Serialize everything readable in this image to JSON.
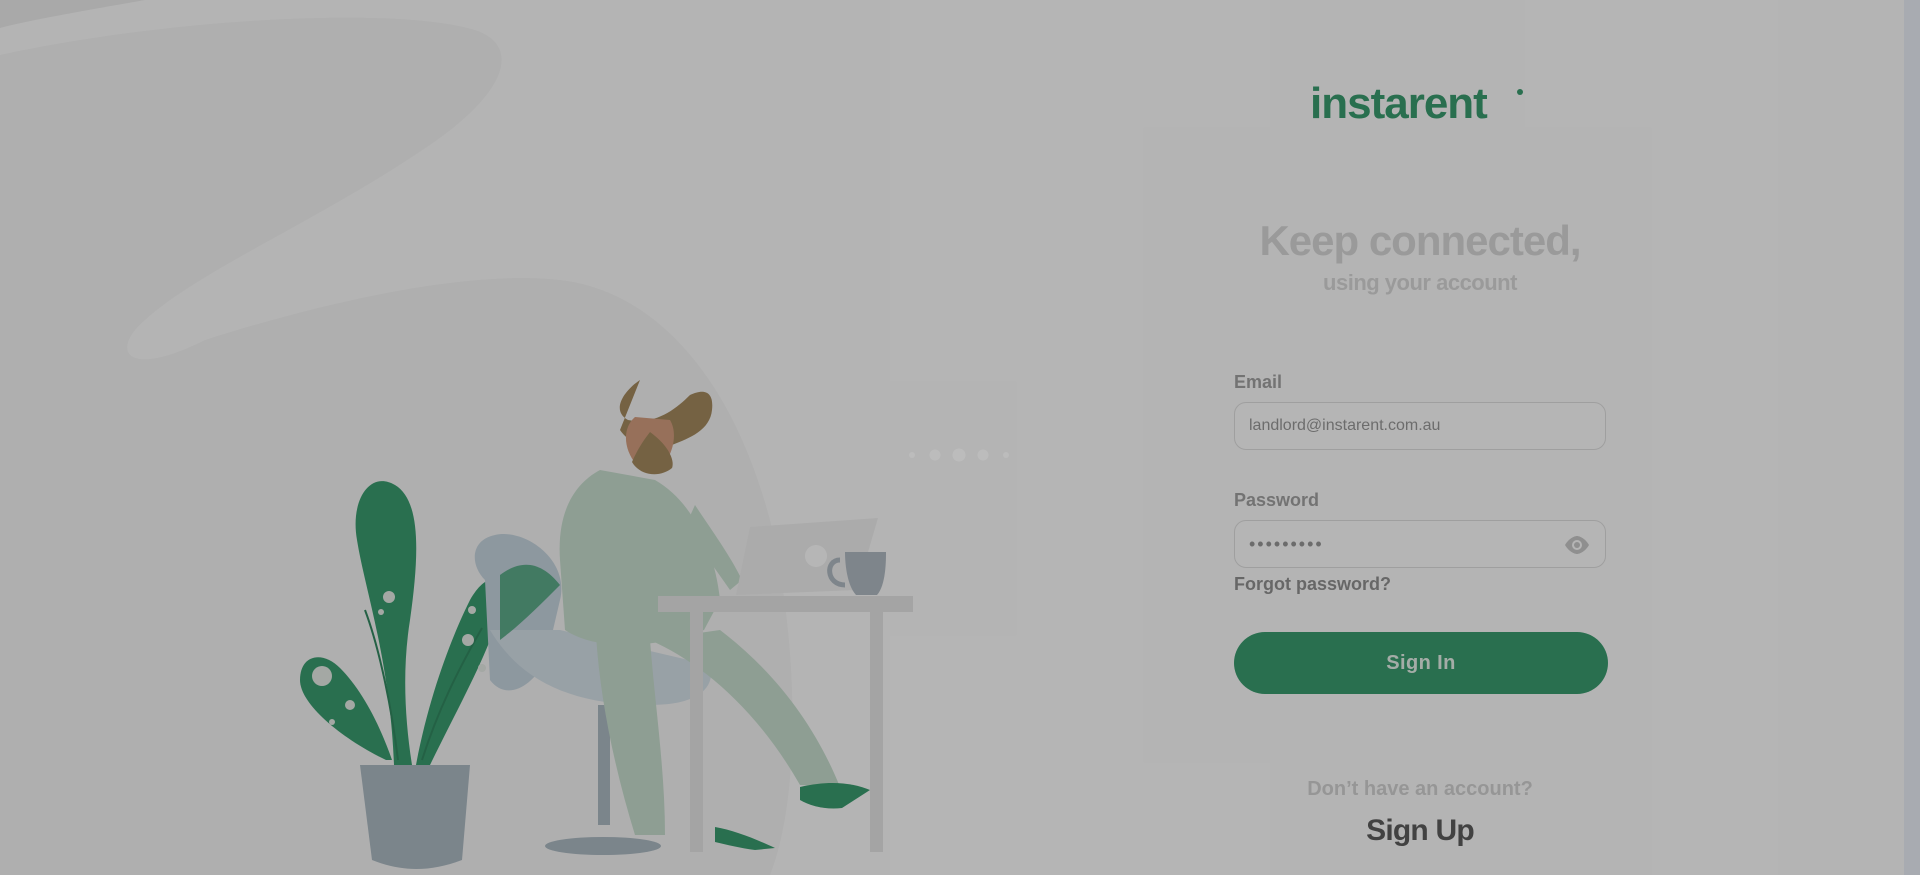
{
  "brand": {
    "logo_text": "instarent",
    "logo_color": "#12844f"
  },
  "hero": {
    "title": "Keep connected,",
    "subtitle": "using your account"
  },
  "form": {
    "email_label": "Email",
    "email_value": "landlord@instarent.com.au",
    "password_label": "Password",
    "password_value": "•••••••••",
    "forgot_password": "Forgot password?",
    "submit_label": "Sign In"
  },
  "footer": {
    "no_account_text": "Don’t have an account?",
    "signup_label": "Sign Up"
  },
  "colors": {
    "accent": "#12844f",
    "overlay": "rgba(80,80,80,0.38)"
  },
  "icons": {
    "password_toggle": "eye-icon",
    "loading": "loading-dots-icon"
  }
}
